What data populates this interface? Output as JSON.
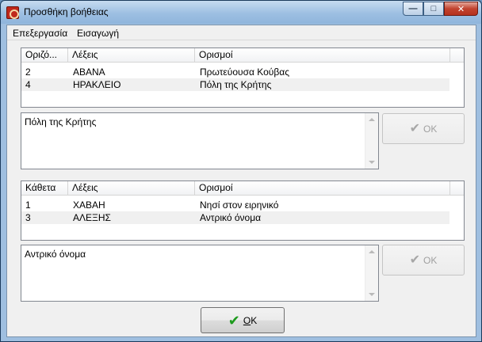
{
  "window": {
    "title": "Προσθήκη βοήθειας",
    "caption_buttons": [
      "minimize",
      "maximize",
      "close"
    ]
  },
  "menu": [
    "Επεξεργασία",
    "Εισαγωγή"
  ],
  "horizontal": {
    "columns": [
      "Οριζό...",
      "Λέξεις",
      "Ορισμοί"
    ],
    "rows": [
      {
        "num": "2",
        "word": "ΑΒΑΝΑ",
        "def": "Πρωτεύουσα Κούβας"
      },
      {
        "num": "4",
        "word": "ΗΡΑΚΛΕΙΟ",
        "def": "Πόλη της Κρήτης"
      }
    ],
    "textbox_value": "Πόλη της Κρήτης",
    "ok_label": "OK"
  },
  "vertical": {
    "columns": [
      "Κάθετα",
      "Λέξεις",
      "Ορισμοί"
    ],
    "rows": [
      {
        "num": "1",
        "word": "ΧΑΒΑΗ",
        "def": "Νησί στον ειρηνικό"
      },
      {
        "num": "3",
        "word": "ΑΛΕΞΗΣ",
        "def": "Αντρικό όνομα"
      }
    ],
    "textbox_value": "Αντρικό όνομα",
    "ok_label": "OK"
  },
  "footer": {
    "ok_label": "OK"
  },
  "icons": {
    "app": "app-icon",
    "check": "checkmark-icon"
  },
  "colors": {
    "title_gradient": "#9dbfe2",
    "close_button": "#c2432f",
    "check_green": "#1c9a1c"
  }
}
